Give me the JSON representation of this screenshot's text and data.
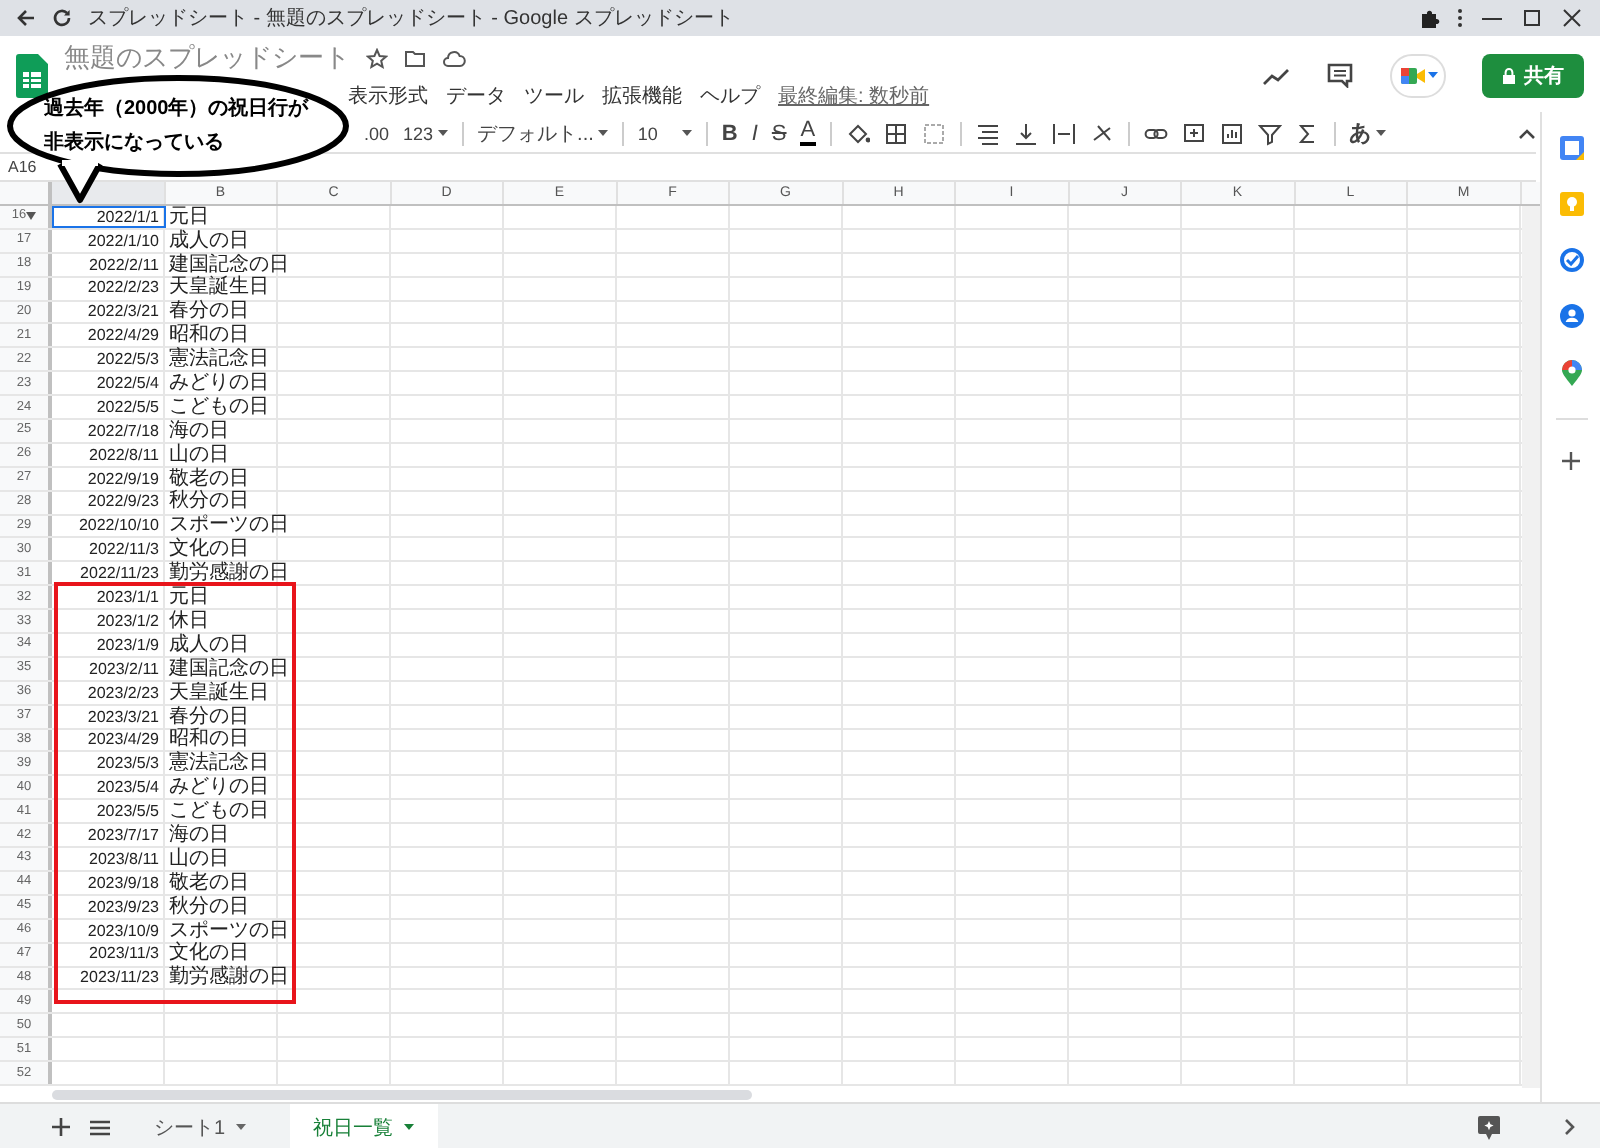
{
  "browser": {
    "title": "スプレッドシート - 無題のスプレッドシート - Google スプレッドシート"
  },
  "app": {
    "doc_title": "無題のスプレッドシート",
    "menu": [
      "表示形式",
      "データ",
      "ツール",
      "拡張機能",
      "ヘルプ"
    ],
    "last_edit": "最終編集: 数秒前",
    "share_label": "共有"
  },
  "toolbar": {
    "decimal": ".00",
    "number_format": "123",
    "font": "デフォルト...",
    "font_size": "10",
    "style_buttons": [
      "B",
      "I",
      "S",
      "A"
    ],
    "input_tool": "あ"
  },
  "name_box": "A16",
  "callout": {
    "lines": [
      "過去年（2000年）の祝日行が",
      "非表示になっている"
    ]
  },
  "columns": [
    "B",
    "C",
    "D",
    "E",
    "F",
    "G",
    "H",
    "I",
    "J",
    "K",
    "L",
    "M"
  ],
  "row_groups": [
    {
      "highlighted": false,
      "rows": [
        {
          "num": "16",
          "date": "2022/1/1",
          "holiday": "元日",
          "selected": true,
          "hidden_above": true
        },
        {
          "num": "17",
          "date": "2022/1/10",
          "holiday": "成人の日",
          "selected": false,
          "hidden_above": false
        },
        {
          "num": "18",
          "date": "2022/2/11",
          "holiday": "建国記念の日",
          "selected": false,
          "hidden_above": false
        },
        {
          "num": "19",
          "date": "2022/2/23",
          "holiday": "天皇誕生日",
          "selected": false,
          "hidden_above": false
        },
        {
          "num": "20",
          "date": "2022/3/21",
          "holiday": "春分の日",
          "selected": false,
          "hidden_above": false
        },
        {
          "num": "21",
          "date": "2022/4/29",
          "holiday": "昭和の日",
          "selected": false,
          "hidden_above": false
        },
        {
          "num": "22",
          "date": "2022/5/3",
          "holiday": "憲法記念日",
          "selected": false,
          "hidden_above": false
        },
        {
          "num": "23",
          "date": "2022/5/4",
          "holiday": "みどりの日",
          "selected": false,
          "hidden_above": false
        },
        {
          "num": "24",
          "date": "2022/5/5",
          "holiday": "こどもの日",
          "selected": false,
          "hidden_above": false
        },
        {
          "num": "25",
          "date": "2022/7/18",
          "holiday": "海の日",
          "selected": false,
          "hidden_above": false
        },
        {
          "num": "26",
          "date": "2022/8/11",
          "holiday": "山の日",
          "selected": false,
          "hidden_above": false
        },
        {
          "num": "27",
          "date": "2022/9/19",
          "holiday": "敬老の日",
          "selected": false,
          "hidden_above": false
        },
        {
          "num": "28",
          "date": "2022/9/23",
          "holiday": "秋分の日",
          "selected": false,
          "hidden_above": false
        },
        {
          "num": "29",
          "date": "2022/10/10",
          "holiday": "スポーツの日",
          "selected": false,
          "hidden_above": false
        },
        {
          "num": "30",
          "date": "2022/11/3",
          "holiday": "文化の日",
          "selected": false,
          "hidden_above": false
        },
        {
          "num": "31",
          "date": "2022/11/23",
          "holiday": "勤労感謝の日",
          "selected": false,
          "hidden_above": false
        }
      ]
    },
    {
      "highlighted": true,
      "rows": [
        {
          "num": "32",
          "date": "2023/1/1",
          "holiday": "元日",
          "selected": false,
          "hidden_above": false
        },
        {
          "num": "33",
          "date": "2023/1/2",
          "holiday": "休日",
          "selected": false,
          "hidden_above": false
        },
        {
          "num": "34",
          "date": "2023/1/9",
          "holiday": "成人の日",
          "selected": false,
          "hidden_above": false
        },
        {
          "num": "35",
          "date": "2023/2/11",
          "holiday": "建国記念の日",
          "selected": false,
          "hidden_above": false
        },
        {
          "num": "36",
          "date": "2023/2/23",
          "holiday": "天皇誕生日",
          "selected": false,
          "hidden_above": false
        },
        {
          "num": "37",
          "date": "2023/3/21",
          "holiday": "春分の日",
          "selected": false,
          "hidden_above": false
        },
        {
          "num": "38",
          "date": "2023/4/29",
          "holiday": "昭和の日",
          "selected": false,
          "hidden_above": false
        },
        {
          "num": "39",
          "date": "2023/5/3",
          "holiday": "憲法記念日",
          "selected": false,
          "hidden_above": false
        },
        {
          "num": "40",
          "date": "2023/5/4",
          "holiday": "みどりの日",
          "selected": false,
          "hidden_above": false
        },
        {
          "num": "41",
          "date": "2023/5/5",
          "holiday": "こどもの日",
          "selected": false,
          "hidden_above": false
        },
        {
          "num": "42",
          "date": "2023/7/17",
          "holiday": "海の日",
          "selected": false,
          "hidden_above": false
        },
        {
          "num": "43",
          "date": "2023/8/11",
          "holiday": "山の日",
          "selected": false,
          "hidden_above": false
        },
        {
          "num": "44",
          "date": "2023/9/18",
          "holiday": "敬老の日",
          "selected": false,
          "hidden_above": false
        },
        {
          "num": "45",
          "date": "2023/9/23",
          "holiday": "秋分の日",
          "selected": false,
          "hidden_above": false
        },
        {
          "num": "46",
          "date": "2023/10/9",
          "holiday": "スポーツの日",
          "selected": false,
          "hidden_above": false
        },
        {
          "num": "47",
          "date": "2023/11/3",
          "holiday": "文化の日",
          "selected": false,
          "hidden_above": false
        },
        {
          "num": "48",
          "date": "2023/11/23",
          "holiday": "勤労感謝の日",
          "selected": false,
          "hidden_above": false
        }
      ]
    },
    {
      "highlighted": false,
      "rows": [
        {
          "num": "49",
          "selected": false,
          "hidden_above": false
        },
        {
          "num": "50",
          "selected": false,
          "hidden_above": false
        },
        {
          "num": "51",
          "selected": false,
          "hidden_above": false
        },
        {
          "num": "52",
          "selected": false,
          "hidden_above": false
        }
      ]
    }
  ],
  "sheet_tabs": [
    {
      "label": "シート1",
      "selected": false
    },
    {
      "label": "祝日一覧",
      "selected": true
    }
  ]
}
